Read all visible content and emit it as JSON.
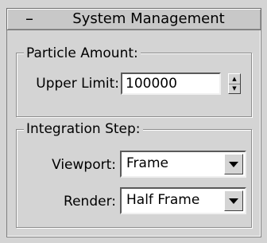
{
  "rollout": {
    "toggle_symbol": "–",
    "title": "System Management"
  },
  "particle_amount": {
    "group_label": "Particle Amount:",
    "upper_limit_label": "Upper Limit:",
    "upper_limit_value": "100000"
  },
  "integration_step": {
    "group_label": "Integration Step:",
    "viewport_label": "Viewport:",
    "viewport_value": "Frame",
    "render_label": "Render:",
    "render_value": "Half Frame"
  },
  "icons": {
    "spinner_up": "▲",
    "spinner_down": "▼"
  }
}
